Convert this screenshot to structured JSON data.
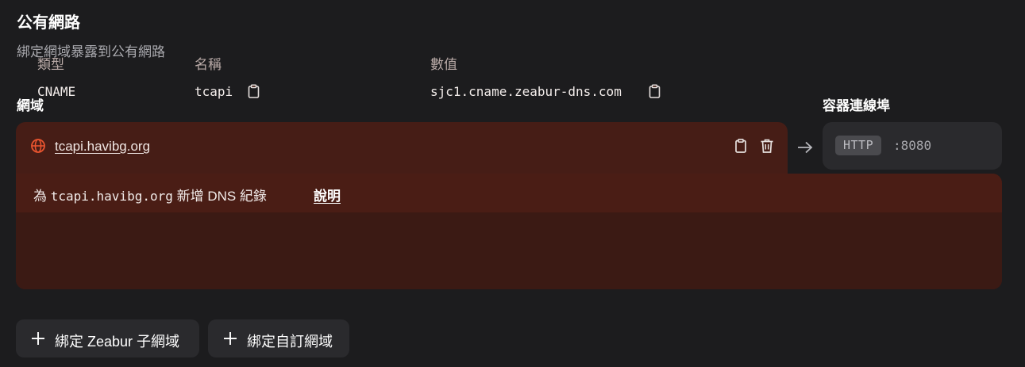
{
  "header": {
    "title": "公有網路",
    "subtitle": "綁定網域暴露到公有網路"
  },
  "labels": {
    "domain": "網域",
    "container_port": "容器連線埠"
  },
  "domain_entry": {
    "domain": "tcapi.havibg.org",
    "icons": [
      "globe-icon",
      "copy-icon",
      "trash-icon",
      "arrow-right-icon"
    ]
  },
  "port": {
    "protocol": "HTTP",
    "value": ":8080"
  },
  "dns": {
    "prefix": "為",
    "domain": "tcapi.havibg.org",
    "suffix": "新增 DNS 紀錄",
    "help_label": "說明",
    "columns": [
      "類型",
      "名稱",
      "數值"
    ],
    "record": {
      "type": "CNAME",
      "name": "tcapi",
      "value": "sjc1.cname.zeabur-dns.com"
    }
  },
  "actions": {
    "bind_zeabur_subdomain": "綁定 Zeabur 子網域",
    "bind_custom_domain": "綁定自訂網域"
  },
  "colors": {
    "background": "#1c1c1e",
    "card_error": "#461d16",
    "accent_orange": "#e8542f",
    "button_bg": "#2a2a2d"
  }
}
